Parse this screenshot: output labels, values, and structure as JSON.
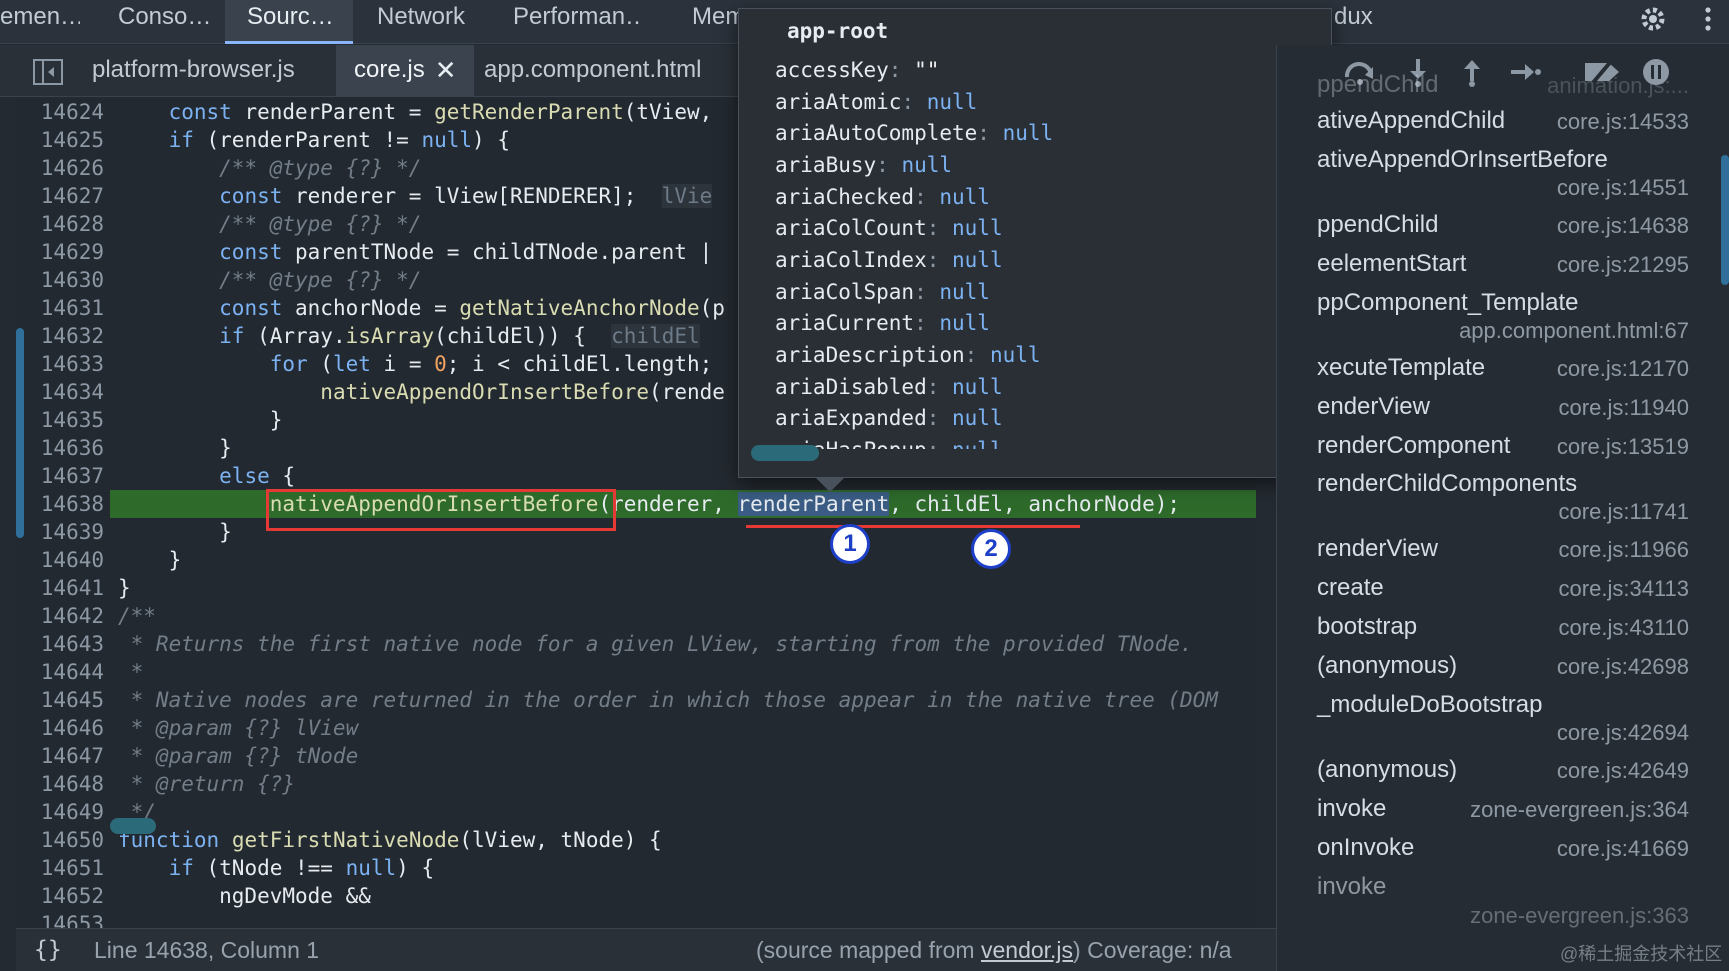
{
  "top_tabs": [
    "emen…",
    "Conso…",
    "Sourc…",
    "Network",
    "Performan…",
    "Mem",
    "dux"
  ],
  "top_tab_active": "Sourc…",
  "file_tabs": [
    "platform-browser.js",
    "core.js",
    "app.component.html"
  ],
  "file_tab_active": "core.js",
  "code": {
    "line_numbers": [
      "14624",
      "14625",
      "14626",
      "14627",
      "14628",
      "14629",
      "14630",
      "14631",
      "14632",
      "14633",
      "14634",
      "14635",
      "14636",
      "14637",
      "14638",
      "14639",
      "14640",
      "14641",
      "14642",
      "14643",
      "14644",
      "14645",
      "14646",
      "14647",
      "14648",
      "14649",
      "14650",
      "14651",
      "14652",
      "14653"
    ],
    "current_line": "14638",
    "inline_values": {
      "line_14627": "lVie",
      "line_14632": "childEl"
    }
  },
  "popover": {
    "title": "app-root",
    "properties": [
      {
        "name": "accessKey",
        "value": "\"\""
      },
      {
        "name": "ariaAtomic",
        "value": "null"
      },
      {
        "name": "ariaAutoComplete",
        "value": "null"
      },
      {
        "name": "ariaBusy",
        "value": "null"
      },
      {
        "name": "ariaChecked",
        "value": "null"
      },
      {
        "name": "ariaColCount",
        "value": "null"
      },
      {
        "name": "ariaColIndex",
        "value": "null"
      },
      {
        "name": "ariaColSpan",
        "value": "null"
      },
      {
        "name": "ariaCurrent",
        "value": "null"
      },
      {
        "name": "ariaDescription",
        "value": "null"
      },
      {
        "name": "ariaDisabled",
        "value": "null"
      },
      {
        "name": "ariaExpanded",
        "value": "null"
      },
      {
        "name": "ariaHasPopup",
        "value": "null"
      }
    ]
  },
  "annotations": {
    "badge1": "1",
    "badge2": "2"
  },
  "call_stack": [
    {
      "name": "ppendChild",
      "loc": "animation.js:..."
    },
    {
      "name": "ativeAppendChild",
      "loc": "core.js:14533"
    },
    {
      "name": "ativeAppendOrInsertBefore",
      "loc": "core.js:14551"
    },
    {
      "name": "ppendChild",
      "loc": "core.js:14638"
    },
    {
      "name": "eelementStart",
      "loc": "core.js:21295"
    },
    {
      "name": "ppComponent_Template",
      "loc": "app.component.html:67"
    },
    {
      "name": "xecuteTemplate",
      "loc": "core.js:12170"
    },
    {
      "name": "enderView",
      "loc": "core.js:11940"
    },
    {
      "name": "renderComponent",
      "loc": "core.js:13519"
    },
    {
      "name": "renderChildComponents",
      "loc": "core.js:11741"
    },
    {
      "name": "renderView",
      "loc": "core.js:11966"
    },
    {
      "name": "create",
      "loc": "core.js:34113"
    },
    {
      "name": "bootstrap",
      "loc": "core.js:43110"
    },
    {
      "name": "(anonymous)",
      "loc": "core.js:42698"
    },
    {
      "name": "_moduleDoBootstrap",
      "loc": "core.js:42694"
    },
    {
      "name": "(anonymous)",
      "loc": "core.js:42649"
    },
    {
      "name": "invoke",
      "loc": "zone-evergreen.js:364"
    },
    {
      "name": "onInvoke",
      "loc": "core.js:41669"
    },
    {
      "name": "invoke",
      "loc": "zone-evergreen.js:363"
    }
  ],
  "status": {
    "braces": "{}",
    "position": "Line 14638, Column 1",
    "source_prefix": "(source mapped from ",
    "source_link": "vendor.js",
    "source_suffix": ")",
    "coverage": "Coverage: n/a"
  },
  "watermark": "@稀土掘金技术社区",
  "colors": {
    "background": "#242a31",
    "exec_line": "#2e6b2b",
    "keyword": "#7cb2f2",
    "annotation_red": "#e53935",
    "badge_blue": "#1e40c8"
  }
}
